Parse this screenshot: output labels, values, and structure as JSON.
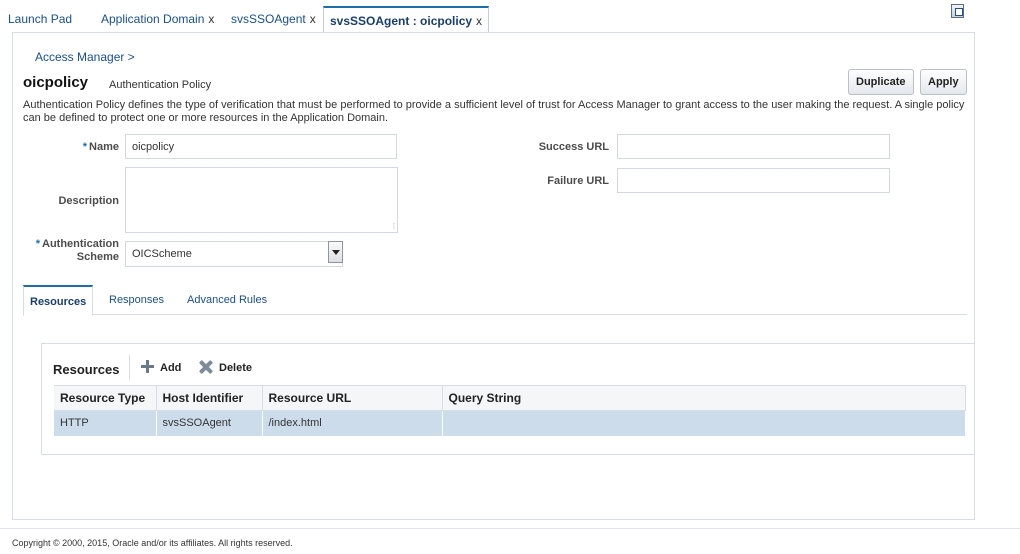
{
  "tabs": [
    {
      "label": "Launch Pad",
      "closable": false
    },
    {
      "label": "Application Domain",
      "closable": true
    },
    {
      "label": "svsSSOAgent",
      "closable": true
    },
    {
      "label": "svsSSOAgent : oicpolicy",
      "closable": true,
      "active": true
    }
  ],
  "close_glyph": "x",
  "breadcrumb": "Access Manager >",
  "policy": {
    "name": "oicpolicy",
    "type": "Authentication Policy",
    "description": "Authentication Policy defines the type of verification that must be performed to provide a sufficient level of trust for Access Manager to grant access to the user making the request. A single policy can be defined to protect one or more resources in the Application Domain."
  },
  "buttons": {
    "duplicate": "Duplicate",
    "apply": "Apply"
  },
  "form": {
    "required_marker": "*",
    "name_label": "Name",
    "name_value": "oicpolicy",
    "description_label": "Description",
    "description_value": "",
    "auth_scheme_label_1": "Authentication",
    "auth_scheme_label_2": "Scheme",
    "auth_scheme_value": "OICScheme",
    "success_url_label": "Success URL",
    "success_url_value": "",
    "failure_url_label": "Failure URL",
    "failure_url_value": ""
  },
  "subtabs": [
    "Resources",
    "Responses",
    "Advanced Rules"
  ],
  "resources": {
    "title": "Resources",
    "add_label": "Add",
    "delete_label": "Delete",
    "columns": [
      "Resource Type",
      "Host Identifier",
      "Resource URL",
      "Query String"
    ],
    "rows": [
      [
        "HTTP",
        "svsSSOAgent",
        "/index.html",
        ""
      ]
    ]
  },
  "footer": "Copyright © 2000, 2015, Oracle and/or its affiliates. All rights reserved.",
  "colors": {
    "accent": "#1b6ea8",
    "link": "#1b4f86",
    "selected_row": "#cddcea"
  }
}
